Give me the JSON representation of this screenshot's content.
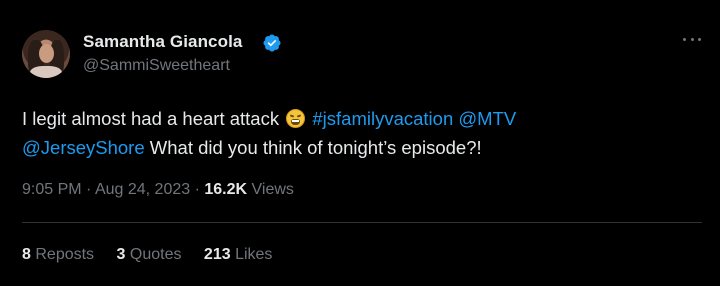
{
  "user": {
    "name": "Samantha Giancola",
    "handle": "@SammiSweetheart",
    "verified": true,
    "verified_color": "#1d9bf0"
  },
  "tweet": {
    "text_part1": "I legit almost had a heart attack ",
    "emoji": "grimacing-face-emoji",
    "hashtag": "#jsfamilyvacation",
    "mention1": "@MTV",
    "mention2": "@JerseyShore",
    "text_part2": " What did you think of tonight’s episode?!"
  },
  "meta": {
    "time": "9:05 PM",
    "separator": "·",
    "date": "Aug 24, 2023",
    "views_count": "16.2K",
    "views_label": "Views"
  },
  "stats": {
    "reposts_count": "8",
    "reposts_label": "Reposts",
    "quotes_count": "3",
    "quotes_label": "Quotes",
    "likes_count": "213",
    "likes_label": "Likes"
  },
  "icons": {
    "more": "more-options-icon",
    "verified": "verified-badge-icon"
  },
  "colors": {
    "background": "#000000",
    "text": "#e7e9ea",
    "secondary": "#71767b",
    "link": "#1d9bf0"
  }
}
